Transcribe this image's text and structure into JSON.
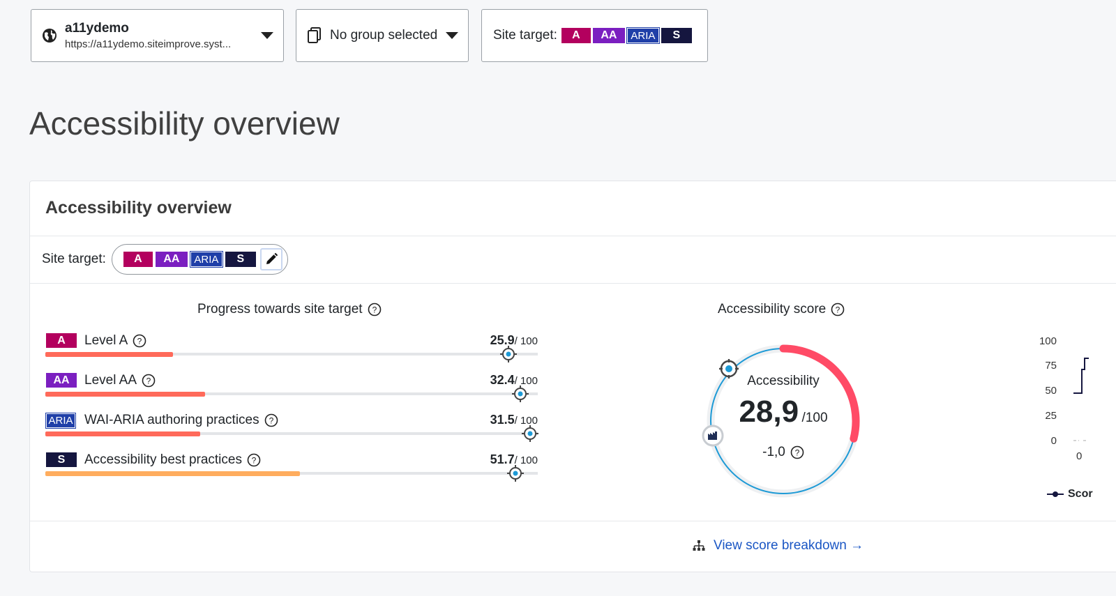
{
  "colors": {
    "level_a": "#b3005e",
    "level_aa": "#7b1fc0",
    "aria": "#1f3fa8",
    "best_practices": "#15163f",
    "progress_low": "#ff6a5a",
    "progress_mid": "#ffad5e",
    "gauge_arc": "#ff4b66",
    "link": "#1a56c4"
  },
  "site_selector": {
    "name": "a11ydemo",
    "url": "https://a11ydemo.siteimprove.syst...",
    "icon": "globe-icon"
  },
  "group_selector": {
    "label": "No group selected",
    "icon": "copy-pages-icon"
  },
  "site_target_filter": {
    "label": "Site target:",
    "badges": [
      "A",
      "AA",
      "ARIA",
      "S"
    ]
  },
  "page_title": "Accessibility overview",
  "card": {
    "title": "Accessibility overview",
    "site_target": {
      "label": "Site target:",
      "badges": [
        "A",
        "AA",
        "ARIA",
        "S"
      ],
      "edit_icon": "pencil-icon"
    },
    "progress": {
      "title": "Progress towards site target",
      "rows": [
        {
          "badge": "A",
          "label": "Level A",
          "score": "25.9",
          "of": "/ 100",
          "progress": 25.9,
          "target": 94
        },
        {
          "badge": "AA",
          "label": "Level AA",
          "score": "32.4",
          "of": "/ 100",
          "progress": 32.4,
          "target": 96.5
        },
        {
          "badge": "ARIA",
          "label": "WAI-ARIA authoring practices",
          "score": "31.5",
          "of": "/ 100",
          "progress": 31.5,
          "target": 98.5
        },
        {
          "badge": "S",
          "label": "Accessibility best practices",
          "score": "51.7",
          "of": "/ 100",
          "progress": 51.7,
          "target": 95.5
        }
      ]
    },
    "score": {
      "title": "Accessibility score",
      "label": "Accessibility",
      "value": "28,9",
      "of": "/100",
      "change": "-1,0",
      "value_num": 28.9
    },
    "trend": {
      "y_ticks": [
        "100",
        "75",
        "50",
        "25",
        "0"
      ],
      "x_tick": "0",
      "legend": "Scor"
    },
    "footer_link": "View score breakdown →"
  }
}
